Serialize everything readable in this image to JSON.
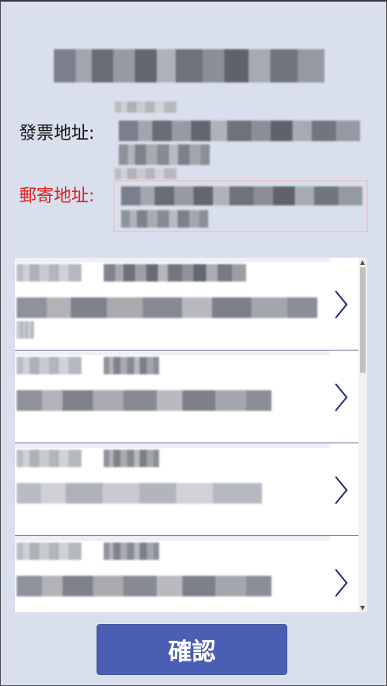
{
  "form": {
    "invoice_label": "發票地址:",
    "mail_label": "郵寄地址:",
    "confirm_label": "確認"
  },
  "list": {
    "item_count": 4
  },
  "colors": {
    "background": "#d9dfed",
    "mail_label": "#e02020",
    "confirm_bg": "#4a5fb4",
    "chevron": "#1e2a6b"
  },
  "icons": {
    "chevron": "chevron-right-icon"
  }
}
